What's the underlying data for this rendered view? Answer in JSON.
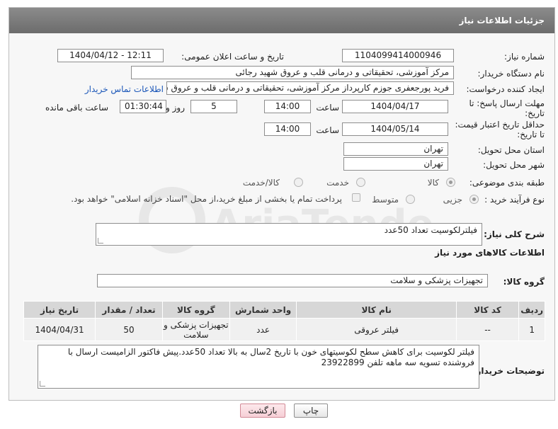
{
  "header": {
    "title": "جزئیات اطلاعات نیاز"
  },
  "fields": {
    "need_number": {
      "label": "شماره نیاز:",
      "value": "1104099414000946"
    },
    "announce_datetime": {
      "label": "تاریخ و ساعت اعلان عمومی:",
      "value": "1404/04/12 - 12:11"
    },
    "buyer_org": {
      "label": "نام دستگاه خریدار:",
      "value": "مرکز آموزشی، تحقیقاتی و درمانی قلب و عروق شهید رجائی"
    },
    "requester": {
      "label": "ایجاد کننده درخواست:",
      "value": "فرید پورجعفری جوزم کارپرداز  مرکز آموزشی، تحقیقاتی و درمانی قلب و عروق شهید رجائی",
      "link": "اطلاعات تماس خریدار"
    },
    "reply_deadline": {
      "label_line1": "مهلت ارسال پاسخ: تا",
      "label_line2": "تاریخ:",
      "date": "1404/04/17",
      "time_label": "ساعت",
      "time": "14:00",
      "days": "5",
      "days_label": "روز و",
      "remaining": "01:30:44",
      "remaining_label": "ساعت باقی مانده"
    },
    "price_validity": {
      "label_line1": "حداقل تاریخ اعتبار قیمت:",
      "label_line2": "تا تاریخ:",
      "date": "1404/05/14",
      "time_label": "ساعت",
      "time": "14:00"
    },
    "delivery_province": {
      "label": "استان محل تحویل:",
      "value": "تهران"
    },
    "delivery_city": {
      "label": "شهر محل تحویل:",
      "value": "تهران"
    },
    "category": {
      "label": "طبقه بندی موضوعی:",
      "options": [
        "کالا",
        "خدمت",
        "کالا/خدمت"
      ],
      "selected": "کالا"
    },
    "process_type": {
      "label": "نوع فرآیند خرید :",
      "options": [
        "جزیی",
        "متوسط"
      ],
      "selected": "جزیی",
      "payment_note": "پرداخت تمام یا بخشی از مبلغ خرید،از محل \"اسناد خزانه اسلامی\" خواهد بود."
    }
  },
  "summary": {
    "label": "شرح کلی نیاز:",
    "value": "فیلترلکوسیت تعداد 50عدد"
  },
  "goods_section": {
    "title": "اطلاعات کالاهای مورد نیاز"
  },
  "goods_group": {
    "label": "گروه کالا:",
    "value": "تجهیزات پزشکی و سلامت"
  },
  "table": {
    "headers": [
      "ردیف",
      "کد کالا",
      "نام کالا",
      "واحد شمارش",
      "گروه کالا",
      "تعداد / مقدار",
      "تاریخ نیاز"
    ],
    "rows": [
      [
        "1",
        "--",
        "فیلتر عروقی",
        "عدد",
        "تجهیزات پزشکی و سلامت",
        "50",
        "1404/04/31"
      ]
    ]
  },
  "buyer_notes": {
    "label": "توضیحات خریدار:",
    "value": "فیلتر لکوسیت برای کاهش سطح لکوسیتهای خون با تاریخ 2سال به بالا تعداد 50عدد.پیش فاکتور الزامیست ارسال با فروشنده تسویه سه ماهه تلفن 23922899"
  },
  "buttons": {
    "print": "چاپ",
    "back": "بازگشت"
  },
  "watermark": {
    "text": "AriaTender.net"
  },
  "colors": {
    "header_bg": "#7a7a7a",
    "link": "#1a56b8",
    "back_button": "#f6cfd6"
  }
}
